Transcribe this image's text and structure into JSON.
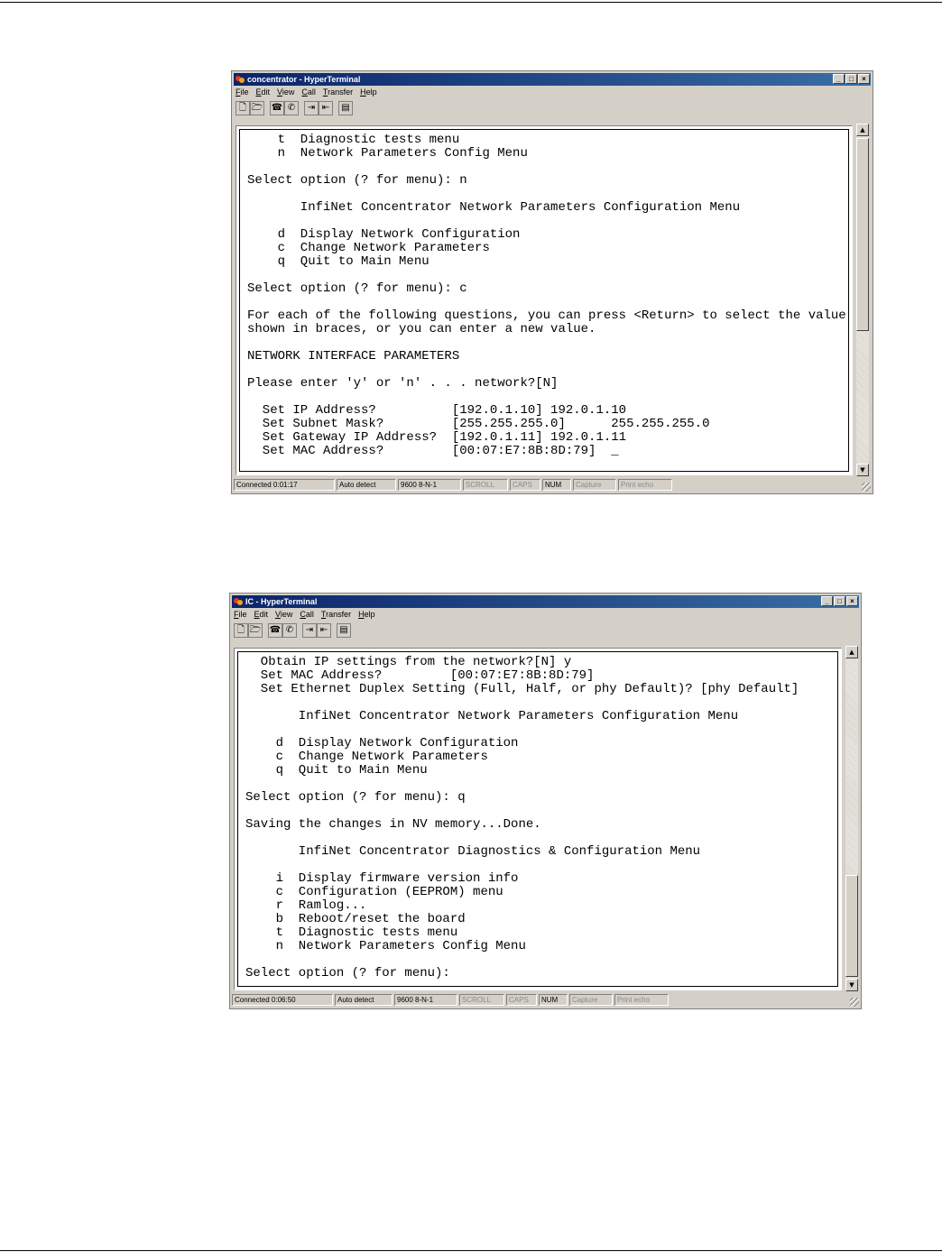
{
  "window1": {
    "title": "concentrator - HyperTerminal",
    "menu": [
      "File",
      "Edit",
      "View",
      "Call",
      "Transfer",
      "Help"
    ],
    "terminal_lines": [
      "    t  Diagnostic tests menu",
      "    n  Network Parameters Config Menu",
      "",
      "Select option (? for menu): n",
      "",
      "       InfiNet Concentrator Network Parameters Configuration Menu",
      "",
      "    d  Display Network Configuration",
      "    c  Change Network Parameters",
      "    q  Quit to Main Menu",
      "",
      "Select option (? for menu): c",
      "",
      "For each of the following questions, you can press <Return> to select the value",
      "shown in braces, or you can enter a new value.",
      "",
      "NETWORK INTERFACE PARAMETERS",
      "",
      "Please enter 'y' or 'n' . . . network?[N]",
      "",
      "  Set IP Address?          [192.0.1.10] 192.0.1.10",
      "  Set Subnet Mask?         [255.255.255.0]      255.255.255.0",
      "  Set Gateway IP Address?  [192.0.1.11] 192.0.1.11",
      "  Set MAC Address?         [00:07:E7:8B:8D:79]  _"
    ],
    "status": [
      "Connected 0:01:17",
      "Auto detect",
      "9600 8-N-1",
      "SCROLL",
      "CAPS",
      "NUM",
      "Capture",
      "Print echo"
    ]
  },
  "window2": {
    "title": "IC - HyperTerminal",
    "menu": [
      "File",
      "Edit",
      "View",
      "Call",
      "Transfer",
      "Help"
    ],
    "terminal_lines": [
      "  Obtain IP settings from the network?[N] y",
      "  Set MAC Address?         [00:07:E7:8B:8D:79]",
      "  Set Ethernet Duplex Setting (Full, Half, or phy Default)? [phy Default]",
      "",
      "       InfiNet Concentrator Network Parameters Configuration Menu",
      "",
      "    d  Display Network Configuration",
      "    c  Change Network Parameters",
      "    q  Quit to Main Menu",
      "",
      "Select option (? for menu): q",
      "",
      "Saving the changes in NV memory...Done.",
      "",
      "       InfiNet Concentrator Diagnostics & Configuration Menu",
      "",
      "    i  Display firmware version info",
      "    c  Configuration (EEPROM) menu",
      "    r  Ramlog...",
      "    b  Reboot/reset the board",
      "    t  Diagnostic tests menu",
      "    n  Network Parameters Config Menu",
      "",
      "Select option (? for menu):"
    ],
    "status": [
      "Connected 0:06:50",
      "Auto detect",
      "9600 8-N-1",
      "SCROLL",
      "CAPS",
      "NUM",
      "Capture",
      "Print echo"
    ]
  }
}
